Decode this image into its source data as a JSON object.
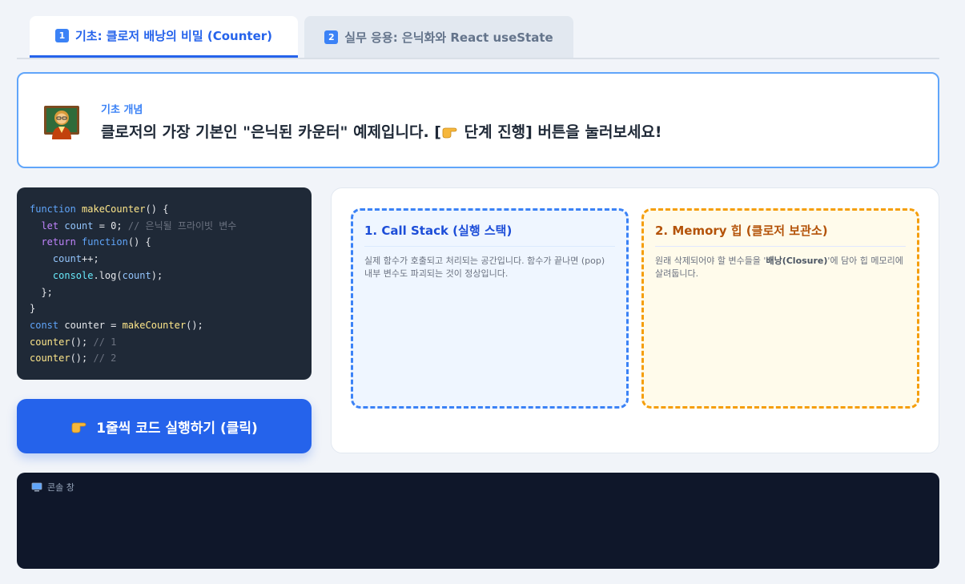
{
  "tabs": [
    {
      "num": "1",
      "label": "기초: 클로저 배낭의 비밀 (Counter)"
    },
    {
      "num": "2",
      "label": "실무 응용: 은닉화와 React useState"
    }
  ],
  "intro": {
    "kicker": "기초 개념",
    "text_before": "클로저의 가장 기본인 \"은닉된 카운터\" 예제입니다. [",
    "text_after": " 단계 진행] 버튼을 눌러보세요!"
  },
  "code": {
    "l1_kw": "function",
    "l1_fn": "makeCounter",
    "l1_rest": "() {",
    "l2_kw": "let",
    "l2_var": "count",
    "l2_rest": " = 0; ",
    "l2_cm": "// 은닉될 프라이빗 변수",
    "l3_kw": "return",
    "l3_kw2": "function",
    "l3_rest": "() {",
    "l4_var": "count",
    "l4_rest": "++;",
    "l5_obj": "console",
    "l5_dot": ".log(",
    "l5_var": "count",
    "l5_rest": ");",
    "l6": "};",
    "l7": "}",
    "l8_kw": "const",
    "l8_mid": " counter = ",
    "l8_fn": "makeCounter",
    "l8_rest": "();",
    "l9_fn": "counter",
    "l9_rest": "(); ",
    "l9_cm": "// 1",
    "l10_fn": "counter",
    "l10_rest": "(); ",
    "l10_cm": "// 2"
  },
  "run_button": {
    "label": "1줄씩 코드 실행하기 (클릭)"
  },
  "stack": {
    "title": "1. Call Stack (실행 스택)",
    "desc": "실제 함수가 호출되고 처리되는 공간입니다. 함수가 끝나면 (pop) 내부 변수도 파괴되는 것이 정상입니다."
  },
  "heap": {
    "title": "2. Memory 힙 (클로저 보관소)",
    "desc_before": "원래 삭제되어야 할 변수들을 '",
    "desc_bold": "배낭(Closure)",
    "desc_after": "'에 담아 힙 메모리에 살려둡니다."
  },
  "console": {
    "label": "콘솔 창"
  },
  "colors": {
    "accent": "#2563eb",
    "stack": "#3b82f6",
    "heap": "#f59e0b",
    "console_bg": "#0f172a"
  }
}
